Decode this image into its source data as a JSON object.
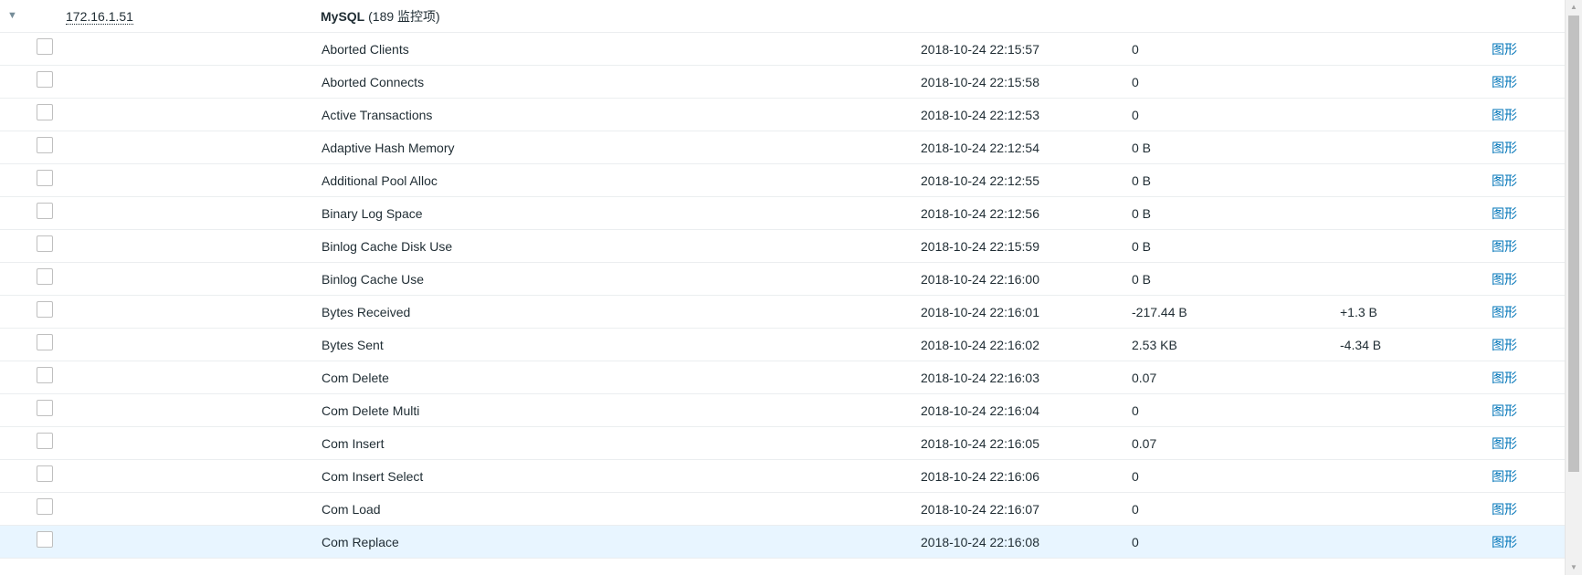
{
  "group": {
    "host": "172.16.1.51",
    "app_name": "MySQL",
    "app_count": "(189 监控项)"
  },
  "icons": {
    "toggle": "triangle-down-icon",
    "toggle_glyph": "▼",
    "scroll_up_glyph": "▲",
    "scroll_down_glyph": "▼"
  },
  "colors": {
    "link": "#0275b8",
    "selected_row": "#e8f5ff"
  },
  "graph_label": "图形",
  "items": [
    {
      "name": "Aborted Clients",
      "time": "2018-10-24 22:15:57",
      "value": "0",
      "change": ""
    },
    {
      "name": "Aborted Connects",
      "time": "2018-10-24 22:15:58",
      "value": "0",
      "change": ""
    },
    {
      "name": "Active Transactions",
      "time": "2018-10-24 22:12:53",
      "value": "0",
      "change": ""
    },
    {
      "name": "Adaptive Hash Memory",
      "time": "2018-10-24 22:12:54",
      "value": "0 B",
      "change": ""
    },
    {
      "name": "Additional Pool Alloc",
      "time": "2018-10-24 22:12:55",
      "value": "0 B",
      "change": ""
    },
    {
      "name": "Binary Log Space",
      "time": "2018-10-24 22:12:56",
      "value": "0 B",
      "change": ""
    },
    {
      "name": "Binlog Cache Disk Use",
      "time": "2018-10-24 22:15:59",
      "value": "0 B",
      "change": ""
    },
    {
      "name": "Binlog Cache Use",
      "time": "2018-10-24 22:16:00",
      "value": "0 B",
      "change": ""
    },
    {
      "name": "Bytes Received",
      "time": "2018-10-24 22:16:01",
      "value": "-217.44 B",
      "change": "+1.3 B"
    },
    {
      "name": "Bytes Sent",
      "time": "2018-10-24 22:16:02",
      "value": "2.53 KB",
      "change": "-4.34 B"
    },
    {
      "name": "Com Delete",
      "time": "2018-10-24 22:16:03",
      "value": "0.07",
      "change": ""
    },
    {
      "name": "Com Delete Multi",
      "time": "2018-10-24 22:16:04",
      "value": "0",
      "change": ""
    },
    {
      "name": "Com Insert",
      "time": "2018-10-24 22:16:05",
      "value": "0.07",
      "change": ""
    },
    {
      "name": "Com Insert Select",
      "time": "2018-10-24 22:16:06",
      "value": "0",
      "change": ""
    },
    {
      "name": "Com Load",
      "time": "2018-10-24 22:16:07",
      "value": "0",
      "change": ""
    },
    {
      "name": "Com Replace",
      "time": "2018-10-24 22:16:08",
      "value": "0",
      "change": "",
      "selected": true
    }
  ]
}
